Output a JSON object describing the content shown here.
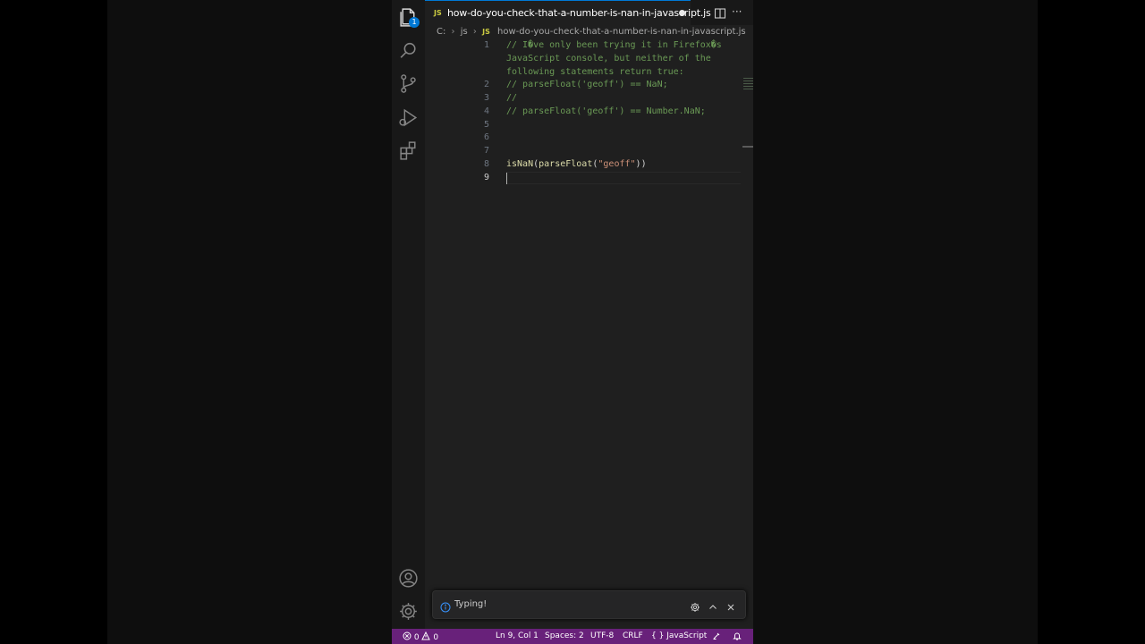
{
  "tab": {
    "file_type": "JS",
    "title": "how-do-you-check-that-a-number-is-nan-in-javascript.js"
  },
  "activity_bar": {
    "explorer_badge": "1",
    "icons": [
      "files-icon",
      "search-icon",
      "source-control-icon",
      "run-debug-icon",
      "extensions-icon",
      "account-icon",
      "gear-icon"
    ]
  },
  "breadcrumb": {
    "drive": "C:",
    "folder": "js",
    "file_type": "JS",
    "file": "how-do-you-check-that-a-number-is-nan-in-javascript.js"
  },
  "code": {
    "line_numbers": [
      "1",
      "2",
      "3",
      "4",
      "5",
      "6",
      "7",
      "8",
      "9"
    ],
    "line1_a": "// I�ve only been trying it in Firefox�s",
    "line1_b": "JavaScript console, but neither of the",
    "line1_c": "following statements return true:",
    "line2": "// parseFloat('geoff') == NaN;",
    "line3": "//",
    "line4": "// parseFloat('geoff') == Number.NaN;",
    "line8_fn1": "isNaN",
    "line8_p1": "(",
    "line8_fn2": "parseFloat",
    "line8_p2": "(",
    "line8_str": "\"geoff\"",
    "line8_p3": "))"
  },
  "notification": {
    "message": "Typing!"
  },
  "status_bar": {
    "errors": "0",
    "warnings": "0",
    "position": "Ln 9, Col 1",
    "spaces": "Spaces: 2",
    "encoding": "UTF-8",
    "eol": "CRLF",
    "language_icon": "{ }",
    "language": "JavaScript"
  },
  "colors": {
    "status_bar": "#68217a",
    "tab_accent": "#0078d4",
    "comment": "#6a9955",
    "function": "#dcdcaa",
    "string": "#ce9178"
  }
}
